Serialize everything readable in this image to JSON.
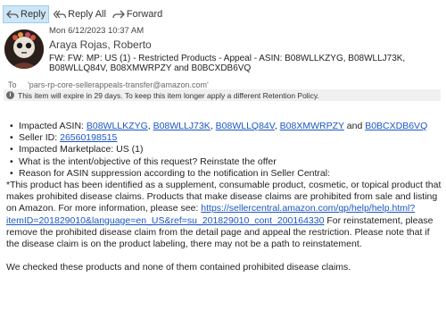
{
  "toolbar": {
    "reply": "Reply",
    "reply_all": "Reply All",
    "forward": "Forward"
  },
  "message": {
    "date": "Mon 6/12/2023 10:37 AM",
    "sender": "Araya Rojas, Roberto",
    "subject": "FW: FW: MP: US (1) - Restricted Products - Appeal - ASIN:  B08WLLKZYG, B08WLLJ73K, B08WLLQ84V, B08XMWRPZY and B0BCXDB6VQ",
    "to_label": "To",
    "to_address": "'pars-rp-core-sellerappeals-transfer@amazon.com'",
    "retention_notice": "This item will expire in 29 days. To keep this item longer apply a different Retention Policy."
  },
  "body": {
    "asin_label": "Impacted ASIN: ",
    "asins": [
      "B08WLLKZYG",
      "B08WLLJ73K",
      "B08WLLQ84V",
      "B08XMWRPZY",
      "B0BCXDB6VQ"
    ],
    "sep_comma": ", ",
    "sep_and": " and ",
    "seller_label": "Seller ID: ",
    "seller_id": "26560198515",
    "marketplace": "Impacted Marketplace: US (1)",
    "intent": "What is the intent/objective of this request? Reinstate the offer",
    "reason": "Reason for ASIN suppression according to the notification in Seller Central:",
    "para1_a": "*This product has been identified as a supplement, consumable product, cosmetic, or topical product that makes prohibited disease claims. Products that make disease claims are prohibited from sale and listing on Amazon. For more information, please see: ",
    "help_link": "https://sellercentral.amazon.com/gp/help/help.html?itemID=201829010&language=en_US&ref=su_201829010_cont_200164330",
    "para1_b": " For reinstatement, please remove the prohibited disease claim from the detail page and appeal the restriction. Please note that if the disease claim is on the product labeling, there may not be a path to reinstatement.",
    "para2": "We checked these products and none of them contained prohibited disease claims."
  }
}
